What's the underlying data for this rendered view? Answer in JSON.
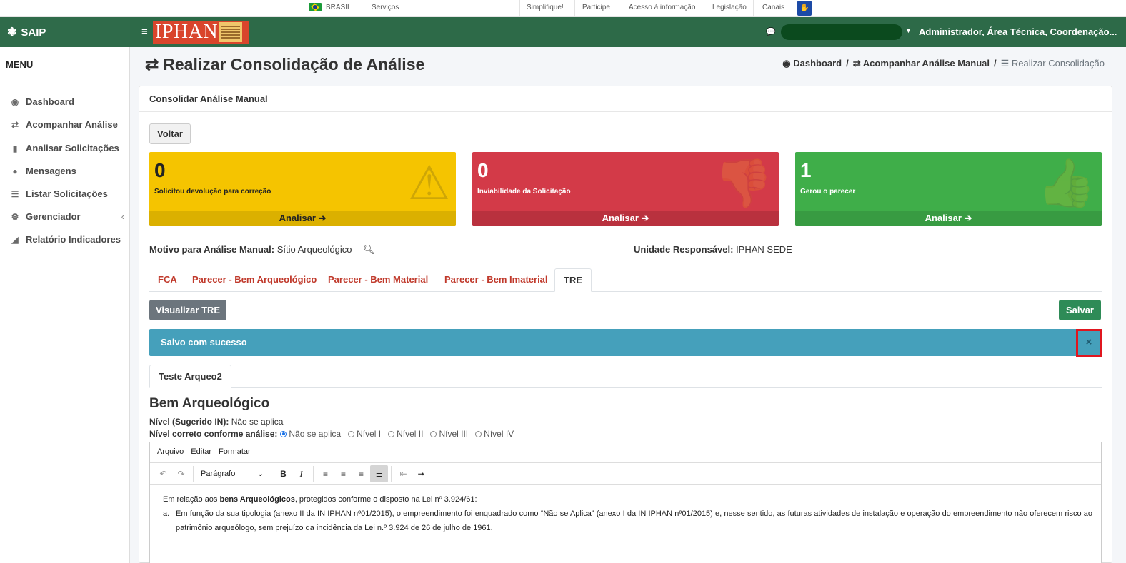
{
  "govbar": {
    "brasil": "BRASIL",
    "servicos": "Serviços",
    "simplifique": "Simplifique!",
    "participe": "Participe",
    "acesso": "Acesso à informação",
    "legislacao": "Legislação",
    "canais": "Canais"
  },
  "header": {
    "app_name": "SAIP",
    "logo_text": "IPHAN",
    "user_name": "Administrador, Área Técnica, Coordenação..."
  },
  "sidebar": {
    "title": "MENU",
    "items": [
      {
        "label": "Dashboard",
        "icon": "dashboard-icon"
      },
      {
        "label": "Acompanhar Análise",
        "icon": "exchange-icon"
      },
      {
        "label": "Analisar Solicitações",
        "icon": "book-icon"
      },
      {
        "label": "Mensagens",
        "icon": "chat-icon"
      },
      {
        "label": "Listar Solicitações",
        "icon": "list-icon"
      },
      {
        "label": "Gerenciador",
        "icon": "gears-icon"
      },
      {
        "label": "Relatório Indicadores",
        "icon": "area-chart-icon"
      }
    ]
  },
  "page": {
    "title": "Realizar Consolidação de Análise",
    "breadcrumb": [
      "Dashboard",
      "/",
      "Acompanhar Análise Manual",
      "/",
      "Realizar Consolidação"
    ]
  },
  "card": {
    "header": "Consolidar Análise Manual",
    "back_button": "Voltar",
    "boxes": [
      {
        "count": "0",
        "label": "Solicitou devolução para correção",
        "action": "Analisar",
        "color": "#f5c400"
      },
      {
        "count": "0",
        "label": "Inviabilidade da Solicitação",
        "action": "Analisar",
        "color": "#d33a48"
      },
      {
        "count": "1",
        "label": "Gerou o parecer",
        "action": "Analisar",
        "color": "#3fae49"
      }
    ],
    "motivo_label": "Motivo para Análise Manual:",
    "motivo_value": "Sítio Arqueológico",
    "unidade_label": "Unidade Responsável:",
    "unidade_value": "IPHAN SEDE",
    "tabs": [
      "FCA",
      "Parecer - Bem Arqueológico",
      "Parecer - Bem Material",
      "Parecer - Bem Imaterial",
      "TRE"
    ],
    "active_tab": "TRE",
    "view_button": "Visualizar TRE",
    "save_button": "Salvar",
    "alert_text": "Salvo com sucesso",
    "alert_close": "×",
    "subtab": "Teste Arqueo2",
    "section_title": "Bem Arqueológico",
    "nivel_sugerido_label": "Nível (Sugerido IN):",
    "nivel_sugerido_value": "Não se aplica",
    "nivel_correto_label": "Nível correto conforme análise:",
    "nivel_options": [
      "Não se aplica",
      "Nível I",
      "Nível II",
      "Nível III",
      "Nível IV"
    ],
    "nivel_selected": "Não se aplica"
  },
  "editor": {
    "menu": [
      "Arquivo",
      "Editar",
      "Formatar"
    ],
    "format_select": "Parágrafo",
    "p1_prefix": "Em relação aos ",
    "p1_bold": "bens Arqueológicos",
    "p1_suffix": ", protegidos conforme o disposto na Lei nº 3.924/61:",
    "item_marker": "a.",
    "item_text": "Em função da sua tipologia (anexo II da IN IPHAN nº01/2015), o empreendimento foi enquadrado como “Não se Aplica” (anexo I da IN IPHAN nº01/2015) e, nesse sentido, as futuras atividades de instalação e operação do empreendimento não oferecem risco ao patrimônio arqueólogo, sem prejuízo da incidência da Lei n.º 3.924 de 26 de julho de 1961."
  }
}
